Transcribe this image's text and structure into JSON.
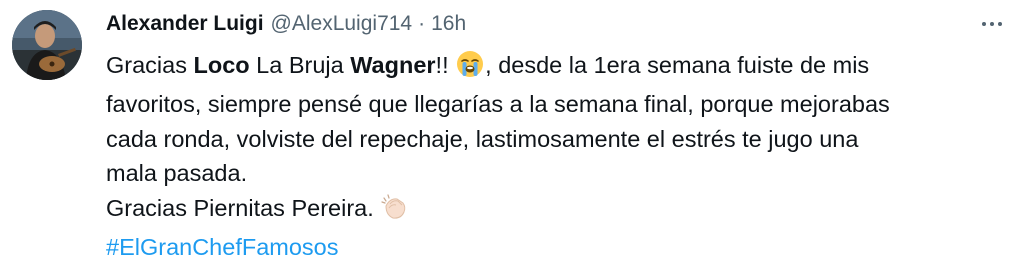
{
  "author": {
    "name": "Alexander Luigi",
    "handle": "@AlexLuigi714",
    "separator": "·",
    "time": "16h"
  },
  "body": {
    "line1": {
      "p1": "Gracias ",
      "p2_bold": "Loco",
      "p3": " La Bruja ",
      "p4_bold": "Wagner",
      "p5": "!! ",
      "p6": ", desde la 1era semana fuiste de mis"
    },
    "line2": "favoritos, siempre pensé que llegarías a la semana final, porque mejorabas",
    "line3": "cada ronda, volviste del repechaje, lastimosamente el estrés te jugo una",
    "line4": "mala pasada.",
    "line5": "Gracias Piernitas Pereira. ",
    "hashtag": "#ElGranChefFamosos"
  },
  "icons": {
    "avatar": "profile-photo",
    "more": "more-horizontal-icon",
    "emoji1": "loudly-crying-face-emoji",
    "emoji2": "clapping-hands-emoji"
  },
  "colors": {
    "text": "#0f1419",
    "secondary": "#536471",
    "link": "#1d9bf0"
  }
}
